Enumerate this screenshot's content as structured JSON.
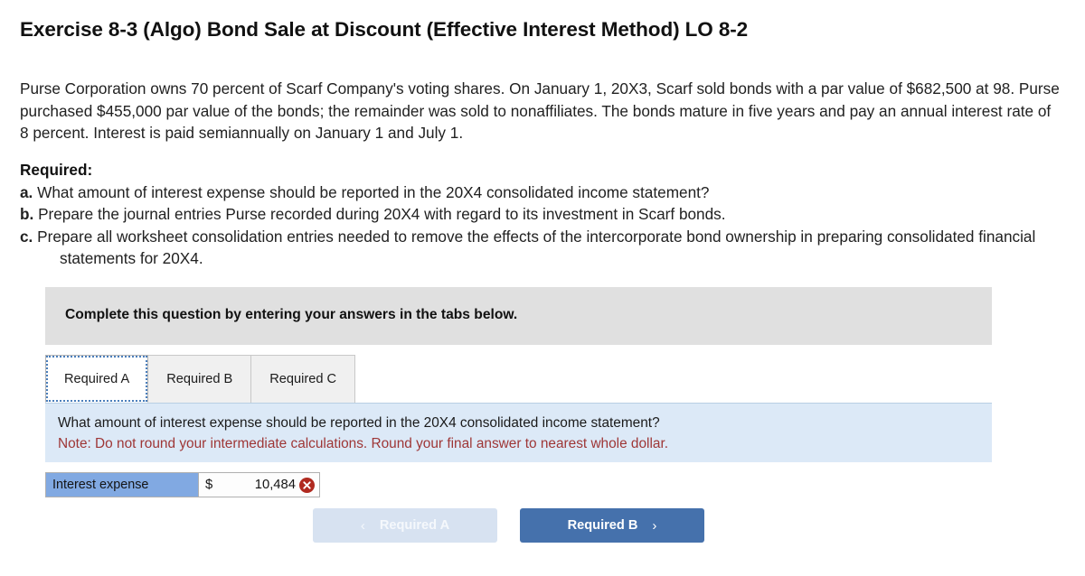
{
  "exercise": {
    "title": "Exercise 8-3 (Algo) Bond Sale at Discount (Effective Interest Method) LO 8-2",
    "problem_text": "Purse Corporation owns 70 percent of Scarf Company's voting shares. On January 1, 20X3, Scarf sold bonds with a par value of $682,500 at 98. Purse purchased $455,000 par value of the bonds; the remainder was sold to nonaffiliates. The bonds mature in five years and pay an annual interest rate of 8 percent. Interest is paid semiannually on January 1 and July 1."
  },
  "required": {
    "heading": "Required:",
    "items": [
      {
        "letter": "a.",
        "text": "What amount of interest expense should be reported in the 20X4 consolidated income statement?"
      },
      {
        "letter": "b.",
        "text": "Prepare the journal entries Purse recorded during 20X4 with regard to its investment in Scarf bonds."
      },
      {
        "letter": "c.",
        "text": "Prepare all worksheet consolidation entries needed to remove the effects of the intercorporate bond ownership in preparing consolidated financial statements for 20X4."
      }
    ]
  },
  "instruction_banner": {
    "text": "Complete this question by entering your answers in the tabs below."
  },
  "tabs": [
    {
      "label": "Required A",
      "active": true
    },
    {
      "label": "Required B",
      "active": false
    },
    {
      "label": "Required C",
      "active": false
    }
  ],
  "panel": {
    "question": "What amount of interest expense should be reported in the 20X4 consolidated income statement?",
    "note": "Note: Do not round your intermediate calculations. Round your final answer to nearest whole dollar."
  },
  "answer_row": {
    "label": "Interest expense",
    "currency": "$",
    "value": "10,484",
    "status_icon": "error-x-circle-icon"
  },
  "nav": {
    "prev_label": "Required A",
    "prev_chevron": "‹",
    "next_label": "Required B",
    "next_chevron": "›"
  },
  "colors": {
    "banner_gray": "#e0e0e0",
    "panel_blue": "#dce9f7",
    "label_blue": "#81a9e2",
    "button_blue": "#4571ac",
    "button_blue_disabled": "#d7e2f1",
    "note_red": "#9e3636",
    "status_red": "#b02a20"
  }
}
